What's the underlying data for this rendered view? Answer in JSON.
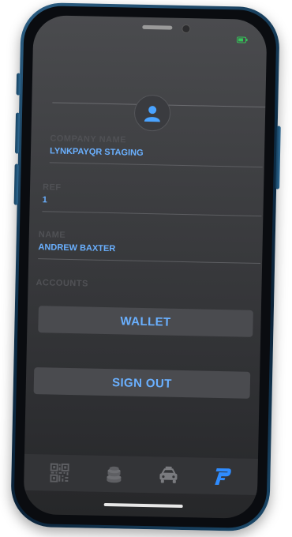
{
  "profile": {
    "company_label": "COMPANY NAME",
    "company_value": "LYNKPAYQR STAGING",
    "ref_label": "REF",
    "ref_value": "1",
    "name_label": "NAME",
    "name_value": "ANDREW BAXTER",
    "accounts_label": "ACCOUNTS"
  },
  "actions": {
    "wallet_label": "WALLET",
    "signout_label": "SIGN OUT"
  },
  "tabbar": {
    "items": [
      {
        "icon": "qr-code-icon",
        "active": false
      },
      {
        "icon": "coins-icon",
        "active": false
      },
      {
        "icon": "taxi-icon",
        "active": false
      },
      {
        "icon": "brand-p-icon",
        "active": true
      }
    ]
  },
  "colors": {
    "accent": "#6ab0ff",
    "active_tab": "#2f8cff",
    "battery": "#34c759",
    "screen_bg": "#3b3c3f"
  }
}
